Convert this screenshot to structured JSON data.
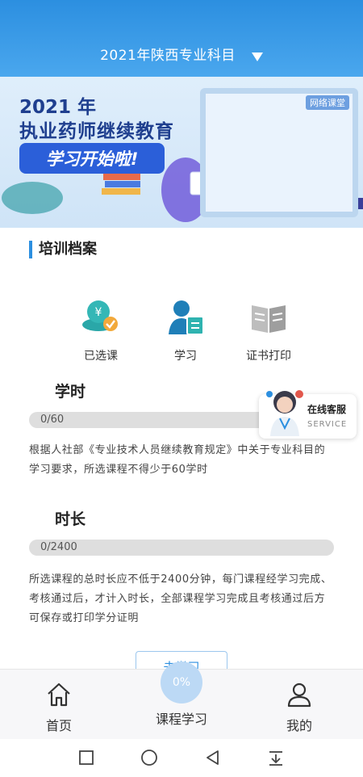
{
  "header": {
    "title": "2021年陕西专业科目"
  },
  "banner": {
    "year": "2021 年",
    "title": "执业药师继续教育",
    "slogan": "学习开始啦!",
    "board_tag": "网络课堂"
  },
  "section": {
    "title": "培训档案"
  },
  "quick_actions": [
    {
      "label": "已选课",
      "icon": "coin-check-icon"
    },
    {
      "label": "学习",
      "icon": "user-card-icon"
    },
    {
      "label": "证书打印",
      "icon": "book-icon"
    }
  ],
  "credit_hours": {
    "title": "学时",
    "progress_text": "0/60",
    "progress_fraction": 0,
    "description": "根据人社部《专业技术人员继续教育规定》中关于专业科目的学习要求，所选课程不得少于60学时"
  },
  "duration": {
    "title": "时长",
    "progress_text": "0/2400",
    "progress_fraction": 0,
    "description": "所选课程的总时长应不低于2400分钟，每门课程经学习完成、考核通过后，才计入时长，全部课程学习完成且考核通过后方可保存或打印学分证明"
  },
  "service": {
    "label": "在线客服",
    "sub": "SERVICE"
  },
  "partial_button": {
    "label": "去学习"
  },
  "tabbar": {
    "home": "首页",
    "course": "课程学习",
    "course_progress": "0%",
    "mine": "我的"
  },
  "colors": {
    "primary": "#2c8fe0",
    "banner_blue": "#2b5fd9",
    "bar_bg": "#dedede"
  }
}
